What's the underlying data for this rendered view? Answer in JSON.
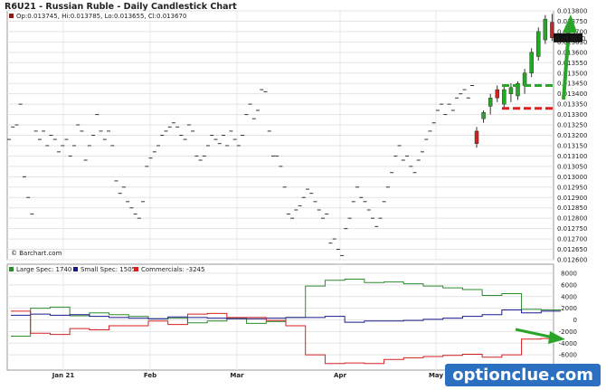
{
  "title": "R6U21 - Russian Ruble - Daily Candlestick Chart",
  "ohlc_label": "Op:0.013745, Hi:0.013785, Lo:0.013655, Cl:0.013670",
  "last_price_tag": "0.013670",
  "source_label": "© Barchart.com",
  "watermark": "optionclue.com",
  "colors": {
    "large_spec": "#2e8b2e",
    "small_spec": "#1a1a8c",
    "commercials": "#d62020",
    "up": "#22aa22",
    "down": "#cc2222",
    "arrow": "#2aa52a",
    "dashed_red": "#e02020"
  },
  "chart_data": [
    {
      "type": "candlestick",
      "ylim": [
        0.0126,
        0.0138
      ],
      "y_ticks": [
        "0.013800",
        "0.013750",
        "0.013700",
        "0.013650",
        "0.013600",
        "0.013550",
        "0.013500",
        "0.013450",
        "0.013400",
        "0.013350",
        "0.013300",
        "0.013250",
        "0.013200",
        "0.013150",
        "0.013100",
        "0.013050",
        "0.013000",
        "0.012950",
        "0.012900",
        "0.012850",
        "0.012800",
        "0.012750",
        "0.012700",
        "0.012650",
        "0.012600"
      ],
      "x_labels": [
        "Jan 21",
        "Feb",
        "Mar",
        "Apr",
        "May"
      ],
      "dashes": [
        0.01318,
        0.01324,
        0.01325,
        0.01335,
        0.013,
        0.0129,
        0.01282,
        0.01322,
        0.01318,
        0.01322,
        0.01315,
        0.0132,
        0.01318,
        0.01312,
        0.01315,
        0.01318,
        0.0131,
        0.01315,
        0.01325,
        0.01322,
        0.01308,
        0.01315,
        0.0132,
        0.0133,
        0.01322,
        0.01318,
        0.01322,
        0.01315,
        0.01298,
        0.01292,
        0.01295,
        0.01288,
        0.01285,
        0.01282,
        0.0128,
        0.01288,
        0.01305,
        0.01309,
        0.01312,
        0.01315,
        0.0132,
        0.01322,
        0.01324,
        0.01326,
        0.01324,
        0.0132,
        0.01318,
        0.01325,
        0.01322,
        0.0131,
        0.01308,
        0.0131,
        0.01315,
        0.0132,
        0.01318,
        0.01316,
        0.0132,
        0.01315,
        0.01322,
        0.01318,
        0.01315,
        0.0132,
        0.0133,
        0.01335,
        0.01328,
        0.01332,
        0.01342,
        0.01341,
        0.01322,
        0.0131,
        0.0131,
        0.01305,
        0.01295,
        0.01282,
        0.0128,
        0.01284,
        0.01286,
        0.0129,
        0.01294,
        0.01292,
        0.01288,
        0.01284,
        0.0128,
        0.01282,
        0.01268,
        0.0127,
        0.01265,
        0.01262,
        0.01275,
        0.0128,
        0.01288,
        0.01295,
        0.0129,
        0.01288,
        0.01284,
        0.0128,
        0.01276,
        0.0128,
        0.01288,
        0.01295,
        0.01302,
        0.0131,
        0.01315,
        0.01308,
        0.0131,
        0.01305,
        0.01302,
        0.01308,
        0.01312,
        0.01318,
        0.01322,
        0.01326,
        0.01332,
        0.01335,
        0.0133,
        0.01335,
        0.01332,
        0.01338,
        0.0134,
        0.01342,
        0.01338,
        0.01344
      ],
      "candles": [
        {
          "o": 0.01322,
          "h": 0.01324,
          "l": 0.01314,
          "c": 0.01316
        },
        {
          "o": 0.01328,
          "h": 0.01332,
          "l": 0.01326,
          "c": 0.01331
        },
        {
          "o": 0.01334,
          "h": 0.0134,
          "l": 0.0133,
          "c": 0.01338
        },
        {
          "o": 0.01342,
          "h": 0.01344,
          "l": 0.01336,
          "c": 0.01338
        },
        {
          "o": 0.01335,
          "h": 0.01344,
          "l": 0.01333,
          "c": 0.01342
        },
        {
          "o": 0.0134,
          "h": 0.01345,
          "l": 0.01336,
          "c": 0.01343
        },
        {
          "o": 0.01339,
          "h": 0.01346,
          "l": 0.01337,
          "c": 0.01345
        },
        {
          "o": 0.01344,
          "h": 0.01352,
          "l": 0.0134,
          "c": 0.0135
        },
        {
          "o": 0.0135,
          "h": 0.01362,
          "l": 0.01348,
          "c": 0.0136
        },
        {
          "o": 0.01358,
          "h": 0.01372,
          "l": 0.01356,
          "c": 0.0137
        },
        {
          "o": 0.01366,
          "h": 0.01378,
          "l": 0.01364,
          "c": 0.01376
        },
        {
          "o": 0.013745,
          "h": 0.013785,
          "l": 0.013655,
          "c": 0.01367
        }
      ],
      "levels": {
        "green_dashed": 0.01344,
        "red_dashed": 0.01333
      }
    },
    {
      "type": "line",
      "legend": [
        "Large Spec: 1740",
        "Small Spec: 1505",
        "Commercials: -3245"
      ],
      "ylim": [
        -8000,
        8000
      ],
      "y_ticks": [
        "8000",
        "6000",
        "4000",
        "2000",
        "0",
        "-2000",
        "-4000",
        "-6000"
      ],
      "weeks": 28,
      "series": [
        {
          "name": "Large Spec",
          "values": [
            -2800,
            2000,
            2200,
            700,
            1200,
            900,
            600,
            200,
            300,
            -500,
            -200,
            300,
            -600,
            -300,
            400,
            5800,
            6800,
            7000,
            6400,
            6500,
            6200,
            5800,
            5500,
            5200,
            4200,
            4500,
            1800,
            1700
          ]
        },
        {
          "name": "Small Spec",
          "values": [
            800,
            1000,
            800,
            900,
            600,
            400,
            300,
            200,
            500,
            400,
            300,
            200,
            200,
            300,
            400,
            400,
            600,
            -400,
            -200,
            -200,
            -100,
            100,
            300,
            600,
            900,
            1700,
            1200,
            1500
          ]
        },
        {
          "name": "Commercials",
          "values": [
            1500,
            -2300,
            -2500,
            -1500,
            -1700,
            -1000,
            -1000,
            -200,
            -800,
            1000,
            1100,
            400,
            400,
            -100,
            -1000,
            -6000,
            -7500,
            -7400,
            -7500,
            -6800,
            -6500,
            -6300,
            -6100,
            -5900,
            -6400,
            -6000,
            -3300,
            -3200
          ]
        }
      ]
    }
  ]
}
